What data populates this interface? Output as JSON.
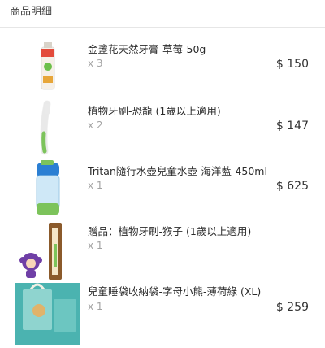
{
  "header": {
    "title": "商品明細"
  },
  "items": [
    {
      "name": "金盞花天然牙膏-草莓-50g",
      "qty": "x 3",
      "price": "$ 150",
      "image": "strawberry-toothpaste-tube"
    },
    {
      "name": "植物牙刷-恐龍 (1歲以上適用)",
      "qty": "x 2",
      "price": "$ 147",
      "image": "white-green-toothbrush"
    },
    {
      "name": "Tritan隨行水壺兒童水壺-海洋藍-450ml",
      "qty": "x 1",
      "price": "$ 625",
      "image": "blue-kids-water-bottle"
    },
    {
      "name": "贈品：植物牙刷-猴子 (1歲以上適用)",
      "qty": "x 1",
      "price": "",
      "image": "monkey-toothbrush-package"
    },
    {
      "name": "兒童睡袋收納袋-字母小熊-薄荷綠 (XL)",
      "qty": "x 1",
      "price": "$ 259",
      "image": "mint-bear-storage-bag"
    }
  ]
}
